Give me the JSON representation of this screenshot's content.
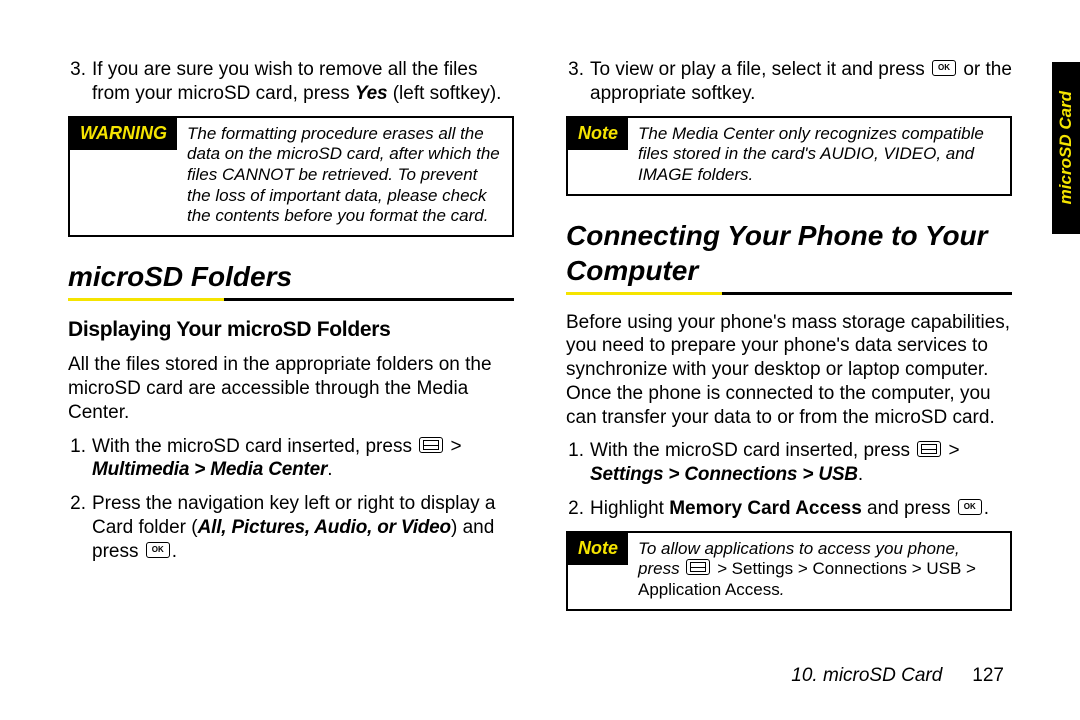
{
  "sidetab": "microSD Card",
  "footer": {
    "chapter": "10. microSD Card",
    "page": "127"
  },
  "left": {
    "step3_a": "If you are sure you wish to remove all the files from your microSD card, press ",
    "step3_key": "Yes",
    "step3_b": " (left softkey).",
    "warning_tag": "WARNING",
    "warning_body": "The formatting procedure erases all the data on the microSD card, after which the files CANNOT be retrieved. To prevent the loss of important data, please check the contents before you format the card.",
    "h1": "microSD Folders",
    "h2": "Displaying Your microSD Folders",
    "intro": "All the files stored in the appropriate folders on the microSD card are accessible through the Media Center.",
    "s1_a": "With the microSD card inserted, press ",
    "s1_b": " > ",
    "s1_path": "Multimedia > Media Center",
    "s1_c": ".",
    "s2_a": "Press the navigation key left or right to display a Card folder (",
    "s2_items": "All, Pictures, Audio, or Video",
    "s2_b": ") and press ",
    "s2_c": "."
  },
  "right": {
    "step3_a": "To view or play a file, select it and press ",
    "step3_b": " or the appropriate softkey.",
    "note1_tag": "Note",
    "note1_body": "The Media Center only recognizes compatible files stored in the card's AUDIO, VIDEO, and IMAGE folders.",
    "h1": "Connecting Your Phone to Your Computer",
    "intro": "Before using your phone's mass storage capabilities, you need to prepare your phone's data services to synchronize with your desktop or laptop computer. Once the phone is connected to the computer, you can transfer your data to or from the microSD card.",
    "s1_a": "With the microSD card inserted, press ",
    "s1_b": " > ",
    "s1_path": "Settings > Connections > USB",
    "s1_c": ".",
    "s2_a": "Highlight ",
    "s2_item": "Memory Card Access",
    "s2_b": " and press ",
    "s2_c": ".",
    "note2_tag": "Note",
    "note2_a": "To allow applications to access you phone, press ",
    "note2_b": " > ",
    "note2_path": "Settings > Connections > USB > Application Access",
    "note2_c": "."
  }
}
